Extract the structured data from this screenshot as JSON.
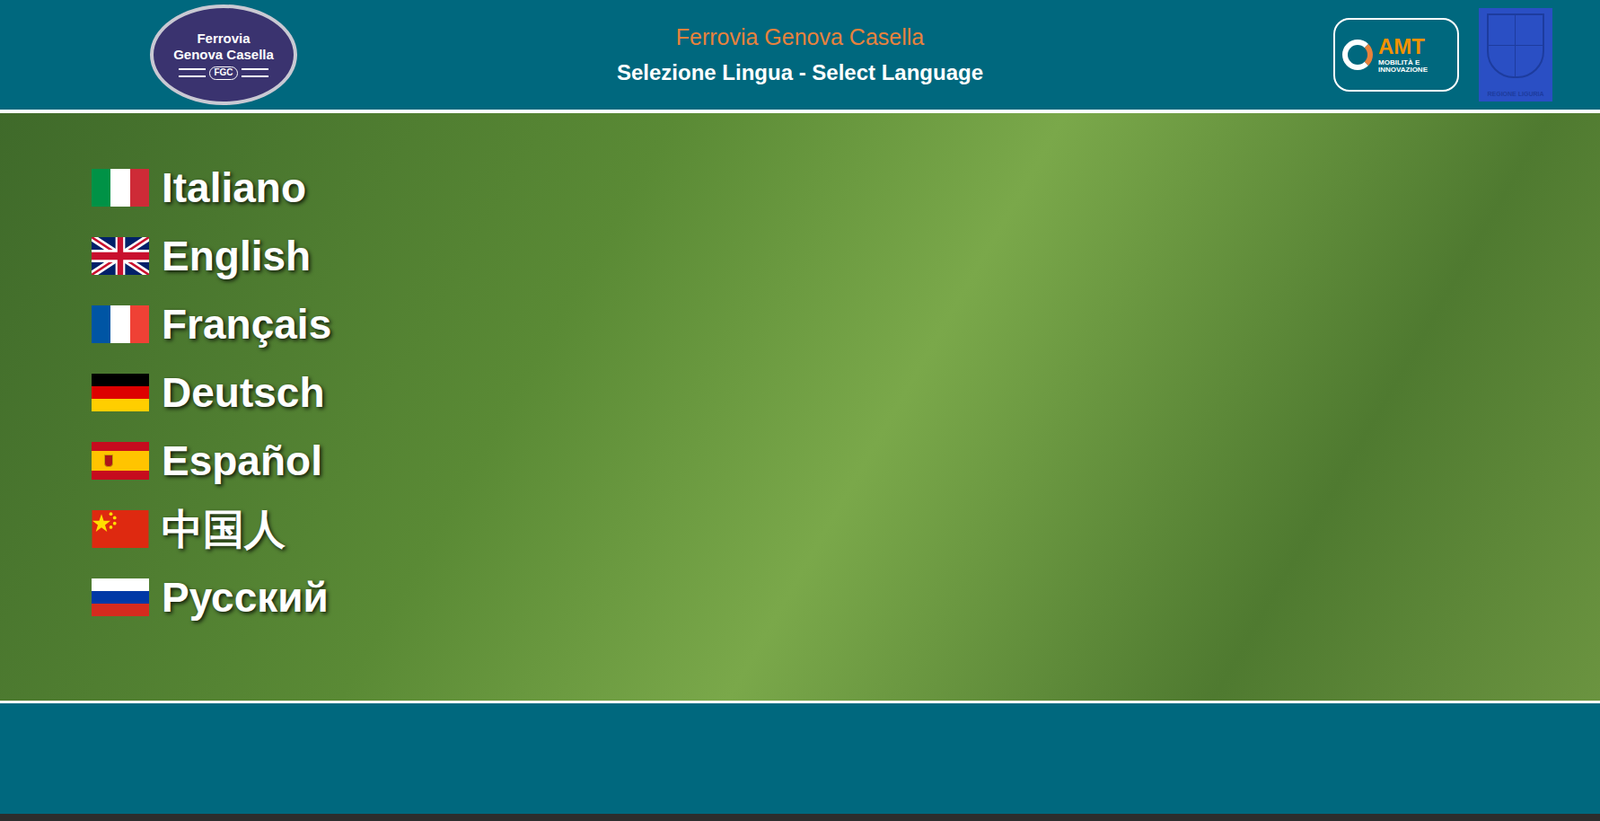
{
  "header": {
    "title": "Ferrovia Genova Casella",
    "subtitle": "Selezione Lingua - Select Language",
    "logo_left": {
      "line1": "Ferrovia",
      "line2": "Genova Casella",
      "mark": "FGC"
    },
    "logo_amt": {
      "name": "AMT",
      "line1": "MOBILITÀ E",
      "line2": "INNOVAZIONE"
    },
    "logo_region": {
      "caption": "REGIONE LIGURIA"
    }
  },
  "languages": [
    {
      "label": "Italiano",
      "kind": "it"
    },
    {
      "label": "English",
      "kind": "gb"
    },
    {
      "label": "Français",
      "kind": "fr"
    },
    {
      "label": "Deutsch",
      "kind": "de"
    },
    {
      "label": "Español",
      "kind": "es"
    },
    {
      "label": "中国人",
      "kind": "cn"
    },
    {
      "label": "Русский",
      "kind": "ru"
    }
  ]
}
